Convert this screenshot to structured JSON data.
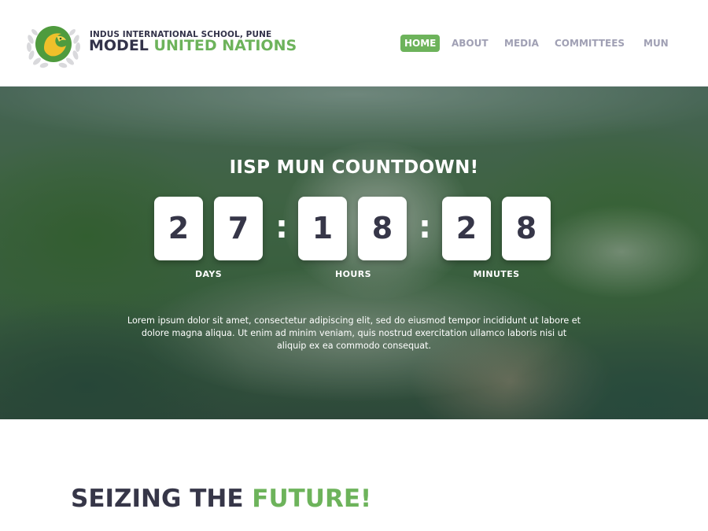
{
  "brand": {
    "school": "INDUS INTERNATIONAL SCHOOL, PUNE",
    "main_prefix": "MODEL",
    "main_accent": "UNITED NATIONS",
    "accent_color": "#6db35b",
    "text_color": "#33334a"
  },
  "nav": {
    "items": [
      {
        "label": "HOME",
        "active": true
      },
      {
        "label": "ABOUT",
        "active": false
      },
      {
        "label": "MEDIA",
        "active": false
      },
      {
        "label": "COMMITTEES",
        "active": false
      },
      {
        "label": "MUN",
        "active": false
      }
    ]
  },
  "countdown": {
    "title": "IISP MUN COUNTDOWN!",
    "days": [
      "2",
      "7"
    ],
    "hours": [
      "1",
      "8"
    ],
    "minutes": [
      "2",
      "8"
    ],
    "separator": ":",
    "labels": {
      "days": "DAYS",
      "hours": "HOURS",
      "minutes": "MINUTES"
    }
  },
  "hero": {
    "text": "Lorem ipsum dolor sit amet, consectetur adipiscing elit, sed do eiusmod tempor incididunt ut labore et dolore magna aliqua. Ut enim ad minim veniam, quis nostrud exercitation ullamco laboris nisi ut aliquip ex ea commodo consequat."
  },
  "section": {
    "title_prefix": "SEIZING THE",
    "title_accent": "FUTURE!"
  },
  "icons": {
    "logo": "un-laurel-eagle-emblem"
  }
}
